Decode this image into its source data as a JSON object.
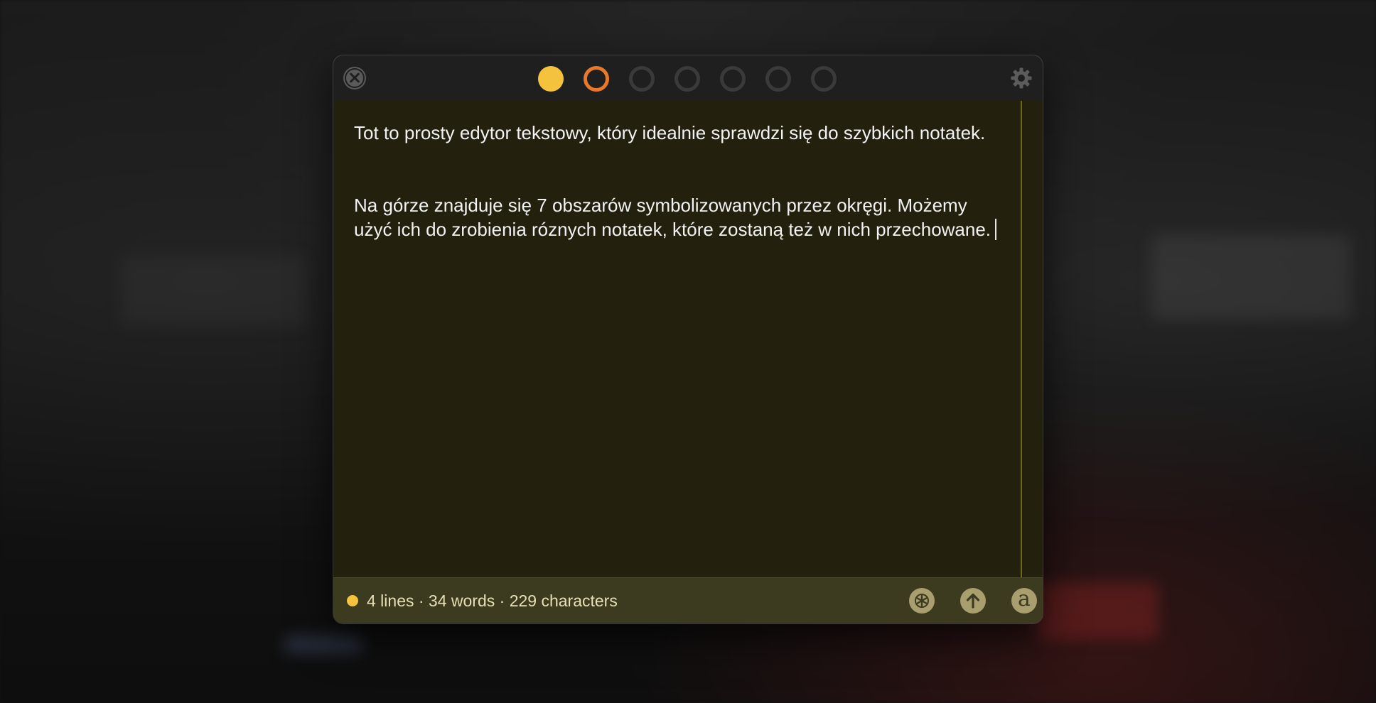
{
  "window": {
    "title_dots": [
      {
        "state": "active-filled",
        "color": "#f4c23d"
      },
      {
        "state": "ring-highlight",
        "color": "#e9782a"
      },
      {
        "state": "ring",
        "color": "#3a3a3a"
      },
      {
        "state": "ring",
        "color": "#3a3a3a"
      },
      {
        "state": "ring",
        "color": "#3a3a3a"
      },
      {
        "state": "ring",
        "color": "#3a3a3a"
      },
      {
        "state": "ring",
        "color": "#3a3a3a"
      }
    ],
    "close_icon": "close-circle-icon",
    "settings_icon": "gear-icon"
  },
  "editor": {
    "paragraph_1": "Tot to prosty edytor tekstowy, który idealnie sprawdzi się do szybkich notatek.",
    "paragraph_2": "Na górze znajduje się 7 obszarów symbolizowanych przez okręgi. Możemy użyć ich do zrobienia róznych notatek, które zostaną też w nich przechowane."
  },
  "statusbar": {
    "stats": "4 lines · 34 words · 229 characters",
    "buttons": [
      {
        "icon": "asterisk-icon"
      },
      {
        "icon": "share-arrow-up-icon"
      },
      {
        "icon": "font-a-icon",
        "glyph": "a"
      }
    ]
  },
  "colors": {
    "accent_yellow": "#f4c23d",
    "accent_orange": "#e9782a",
    "editor_bg": "#23200e",
    "statusbar_bg": "#3c3a1f"
  }
}
